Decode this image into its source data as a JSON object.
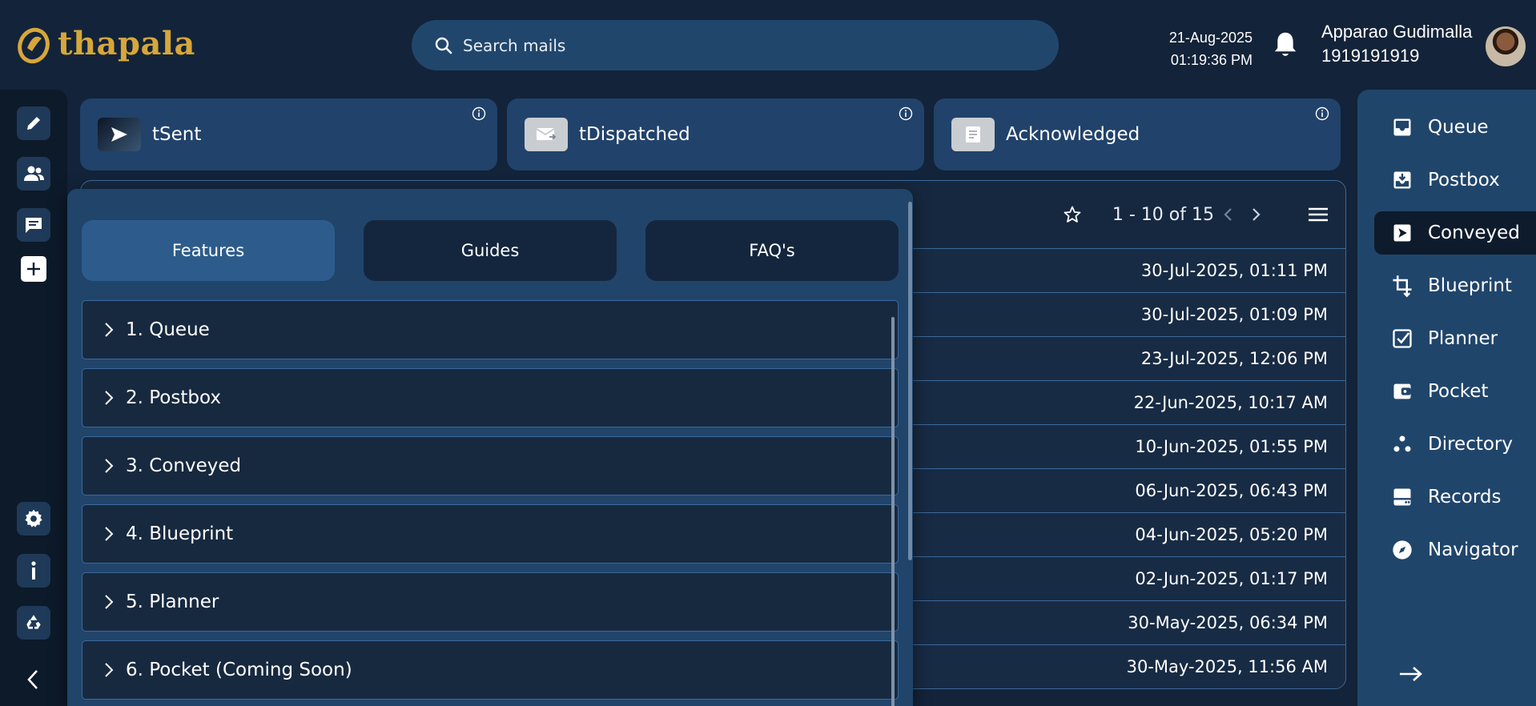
{
  "app": {
    "logo_text": "thapala"
  },
  "header": {
    "search_placeholder": "Search mails",
    "date": "21-Aug-2025",
    "time": "01:19:36 PM",
    "user_name": "Apparao Gudimalla",
    "user_phone": "1919191919"
  },
  "cards": [
    {
      "label": "tSent"
    },
    {
      "label": "tDispatched"
    },
    {
      "label": "Acknowledged"
    }
  ],
  "list": {
    "pagination": "1 - 10 of 15",
    "rows": [
      "30-Jul-2025, 01:11 PM",
      "30-Jul-2025, 01:09 PM",
      "23-Jul-2025, 12:06 PM",
      "22-Jun-2025, 10:17 AM",
      "10-Jun-2025, 01:55 PM",
      "06-Jun-2025, 06:43 PM",
      "04-Jun-2025, 05:20 PM",
      "02-Jun-2025, 01:17 PM",
      "30-May-2025, 06:34 PM",
      "30-May-2025, 11:56 AM"
    ]
  },
  "help": {
    "tabs": [
      "Features",
      "Guides",
      "FAQ's"
    ],
    "active_tab": "Features",
    "items": [
      "1. Queue",
      "2. Postbox",
      "3. Conveyed",
      "4. Blueprint",
      "5. Planner",
      "6. Pocket (Coming Soon)"
    ]
  },
  "nav": {
    "active": "Conveyed",
    "items": [
      "Queue",
      "Postbox",
      "Conveyed",
      "Blueprint",
      "Planner",
      "Pocket",
      "Directory",
      "Records",
      "Navigator"
    ]
  },
  "colors": {
    "background": "#132339",
    "accent_gold": "#d6a73a",
    "panel": "#21446a",
    "active_tab": "#2d5c8c"
  }
}
